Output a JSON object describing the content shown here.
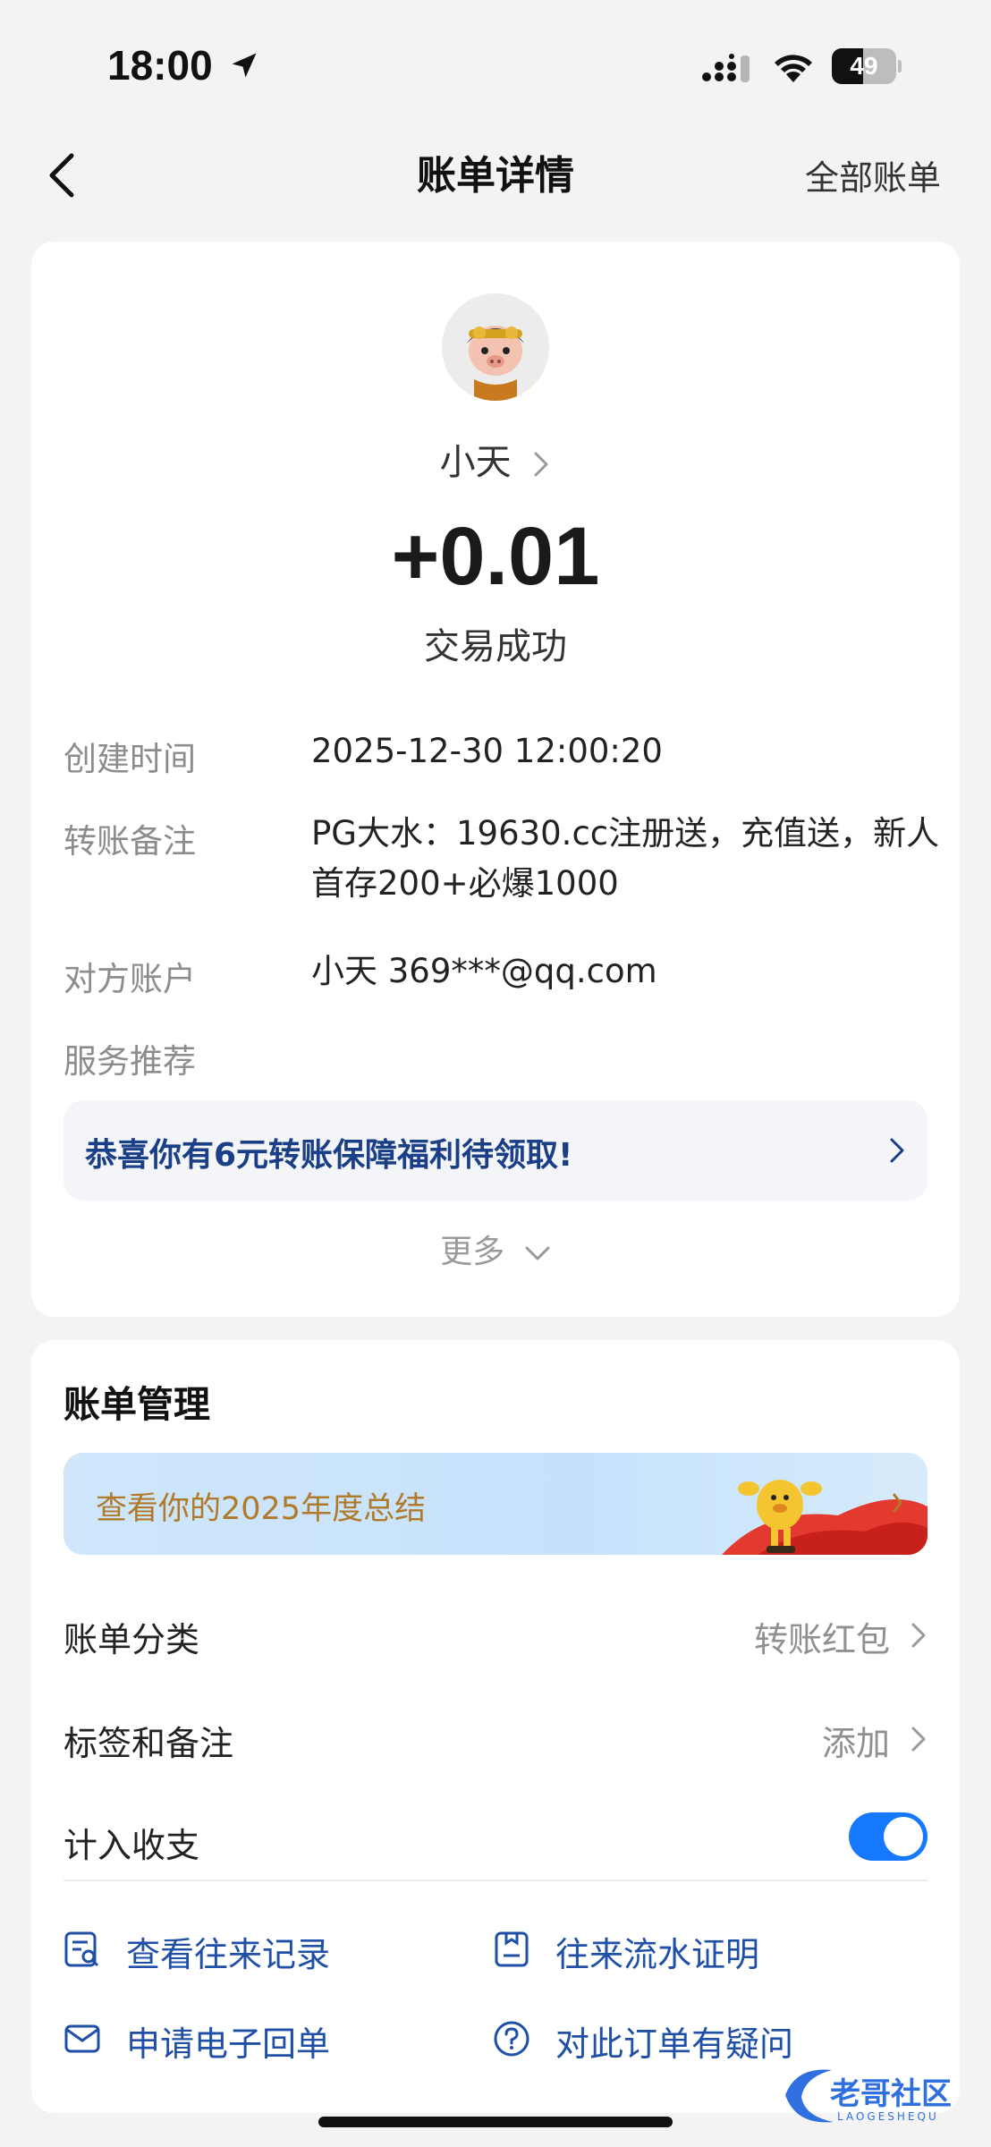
{
  "status_bar": {
    "time": "18:00",
    "battery_level": "49",
    "battery_fraction": 0.49
  },
  "nav": {
    "title": "账单详情",
    "right_link": "全部账单"
  },
  "transaction": {
    "payee": "小天",
    "amount": "+0.01",
    "status": "交易成功",
    "details": [
      {
        "label": "创建时间",
        "value": "2025-12-30 12:00:20"
      },
      {
        "label": "转账备注",
        "value": "PG大水：19630.cc注册送，充值送，新人首存200+必爆1000"
      },
      {
        "label": "对方账户",
        "value": "小天 369***@qq.com"
      }
    ],
    "service_label": "服务推荐",
    "promo": "恭喜你有6元转账保障福利待领取!",
    "more": "更多"
  },
  "management": {
    "title": "账单管理",
    "banner": "查看你的2025年度总结",
    "rows": [
      {
        "label": "账单分类",
        "value": "转账红包"
      },
      {
        "label": "标签和备注",
        "value": "添加"
      },
      {
        "label": "计入收支",
        "toggle_on": true
      }
    ],
    "actions": [
      {
        "label": "查看往来记录",
        "icon": "record-search-icon"
      },
      {
        "label": "往来流水证明",
        "icon": "statement-icon"
      },
      {
        "label": "申请电子回单",
        "icon": "mail-icon"
      },
      {
        "label": "对此订单有疑问",
        "icon": "question-icon"
      }
    ]
  },
  "watermark": {
    "text": "老哥社区",
    "subtext": "LAOGESHEQU"
  },
  "colors": {
    "accent": "#1677ff",
    "link": "#1f4fa6",
    "promo_text": "#1b3f86",
    "banner_text": "#b07a2a"
  }
}
